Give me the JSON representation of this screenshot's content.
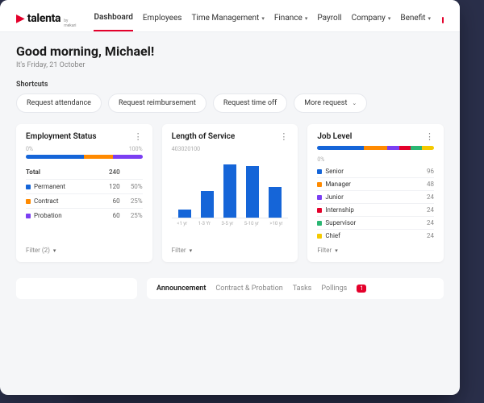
{
  "logo": {
    "text": "talenta",
    "sub": "by mekari"
  },
  "nav": {
    "dashboard": "Dashboard",
    "employees": "Employees",
    "time": "Time Management",
    "finance": "Finance",
    "payroll": "Payroll",
    "company": "Company",
    "benefit": "Benefit"
  },
  "greeting": {
    "title": "Good morning, Michael!",
    "date": "It's Friday, 21 October"
  },
  "shortcuts": {
    "label": "Shortcuts",
    "items": {
      "attendance": "Request attendance",
      "reimbursement": "Request reimbursement",
      "timeoff": "Request time off",
      "more": "More request"
    }
  },
  "cards": {
    "employment": {
      "title": "Employment Status",
      "left_pct": "0%",
      "right_pct": "100%",
      "total_label": "Total",
      "total_value": "240",
      "rows": [
        {
          "label": "Permanent",
          "v1": "120",
          "v2": "50%",
          "color": "#1565d8"
        },
        {
          "label": "Contract",
          "v1": "60",
          "v2": "25%",
          "color": "#ff8a00"
        },
        {
          "label": "Probation",
          "v1": "60",
          "v2": "25%",
          "color": "#7b3ff2"
        }
      ],
      "filter": "Filter (2)"
    },
    "service": {
      "title": "Length of Service",
      "code": "403020100",
      "labels": [
        "<1 yr",
        "1-3 Yr",
        "3-5 yr",
        "5-10 yr",
        ">10 yr"
      ],
      "filter": "Filter"
    },
    "job": {
      "title": "Job Level",
      "left_pct": "0%",
      "rows": [
        {
          "label": "Senior",
          "v": "96",
          "color": "#1565d8"
        },
        {
          "label": "Manager",
          "v": "48",
          "color": "#ff8a00"
        },
        {
          "label": "Junior",
          "v": "24",
          "color": "#7b3ff2"
        },
        {
          "label": "Internship",
          "v": "24",
          "color": "#e4002b"
        },
        {
          "label": "Supervisor",
          "v": "24",
          "color": "#2bb673"
        },
        {
          "label": "Chief",
          "v": "24",
          "color": "#f4c900"
        }
      ],
      "filter": "Filter"
    }
  },
  "bottom": {
    "announcement": "Announcement",
    "contract": "Contract & Probation",
    "tasks": "Tasks",
    "pollings": "Pollings",
    "badge": "1"
  },
  "chart_data": [
    {
      "type": "bar-stacked-horizontal-pct",
      "title": "Employment Status",
      "categories": [
        "Permanent",
        "Contract",
        "Probation"
      ],
      "values": [
        50,
        25,
        25
      ],
      "colors": [
        "#1565d8",
        "#ff8a00",
        "#7b3ff2"
      ],
      "ylim": [
        0,
        100
      ]
    },
    {
      "type": "bar",
      "title": "Length of Service",
      "categories": [
        "<1 yr",
        "1-3 Yr",
        "3-5 yr",
        "5-10 yr",
        ">10 yr"
      ],
      "values": [
        10,
        30,
        60,
        58,
        35
      ],
      "colors": [
        "#1565d8"
      ],
      "ylim": [
        0,
        70
      ]
    },
    {
      "type": "bar-stacked-horizontal-pct",
      "title": "Job Level",
      "categories": [
        "Senior",
        "Manager",
        "Junior",
        "Internship",
        "Supervisor",
        "Chief"
      ],
      "values": [
        40,
        20,
        10,
        10,
        10,
        10
      ],
      "colors": [
        "#1565d8",
        "#ff8a00",
        "#7b3ff2",
        "#e4002b",
        "#2bb673",
        "#f4c900"
      ],
      "ylim": [
        0,
        100
      ]
    }
  ]
}
